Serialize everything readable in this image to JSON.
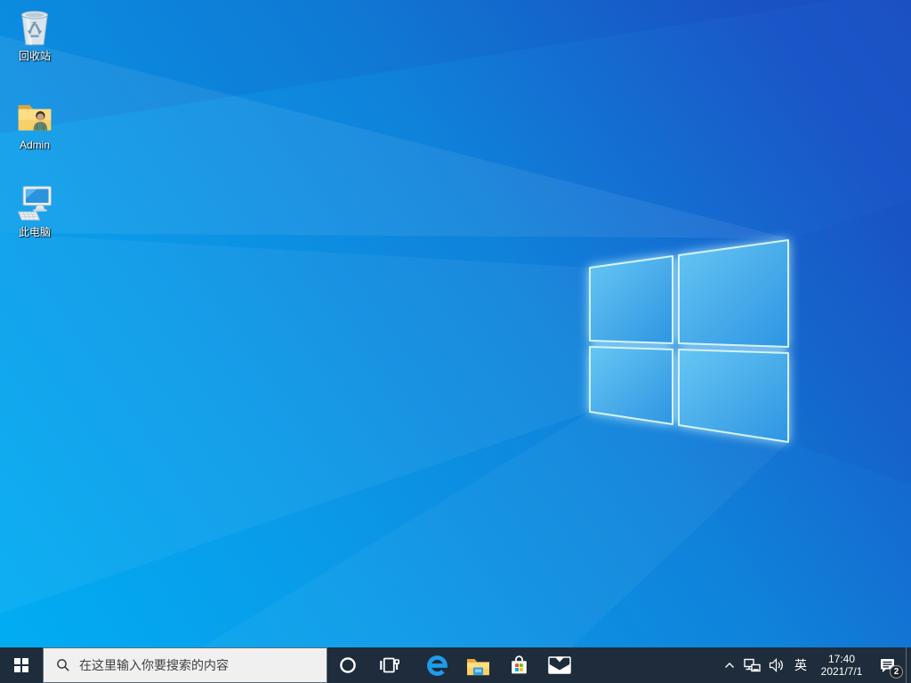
{
  "desktop": {
    "icons": [
      {
        "name": "recycle-bin",
        "label": "回收站"
      },
      {
        "name": "admin-folder",
        "label": "Admin"
      },
      {
        "name": "this-pc",
        "label": "此电脑"
      }
    ]
  },
  "taskbar": {
    "start_tooltip": "start",
    "search": {
      "placeholder": "在这里输入你要搜索的内容"
    },
    "app_buttons": [
      "cortana",
      "task-view",
      "edge",
      "file-explorer",
      "store",
      "mail"
    ],
    "tray": {
      "language": "英",
      "time": "17:40",
      "date": "2021/7/1",
      "notification_badge": "2"
    }
  },
  "colors": {
    "taskbar_bg": "#1e2c3b",
    "search_bg": "#f0f0f0",
    "wallpaper_cyan": "#00aef4",
    "wallpaper_royal": "#1a57c8",
    "edge_blue": "#1d9ce9",
    "store_red": "#f25022",
    "store_green": "#7fba00",
    "store_blue": "#00a4ef",
    "store_yellow": "#ffb900"
  }
}
